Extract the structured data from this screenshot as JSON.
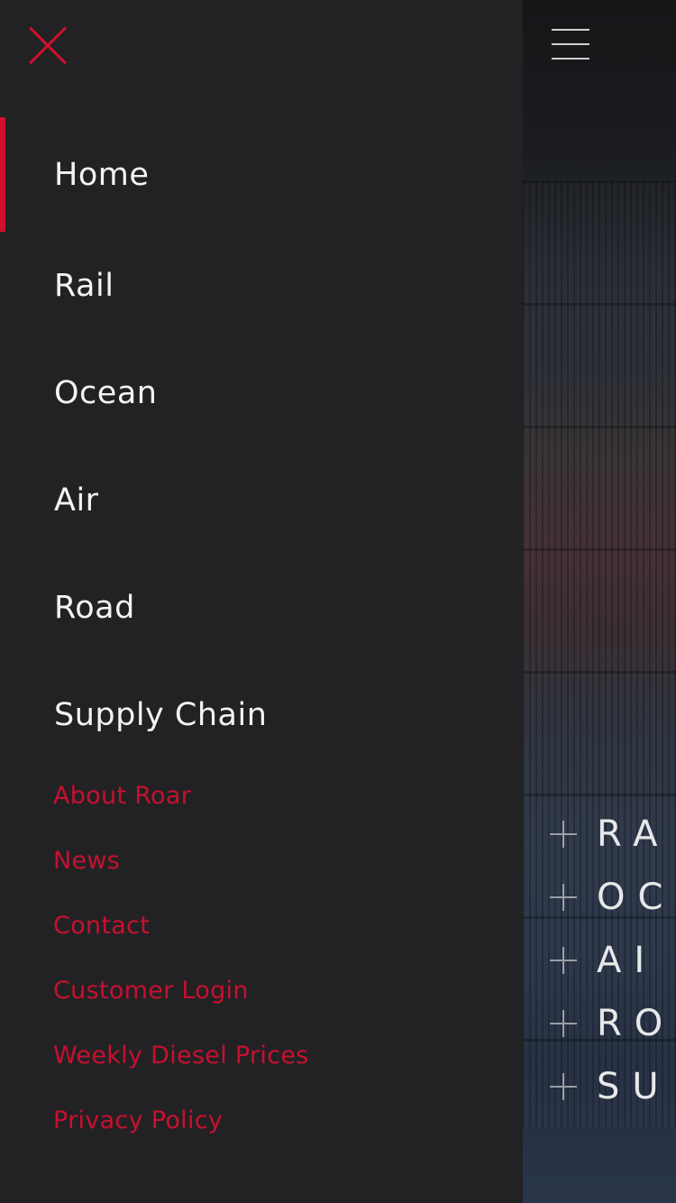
{
  "colors": {
    "accent": "#d0102e",
    "drawer_bg": "#222224",
    "primary_text": "#f3f3f3"
  },
  "drawer": {
    "close_icon": "close-icon",
    "primary_nav": [
      {
        "label": "Home",
        "active": true
      },
      {
        "label": "Rail",
        "active": false
      },
      {
        "label": "Ocean",
        "active": false
      },
      {
        "label": "Air",
        "active": false
      },
      {
        "label": "Road",
        "active": false
      },
      {
        "label": "Supply Chain",
        "active": false
      }
    ],
    "secondary_nav": [
      {
        "label": "About Roar"
      },
      {
        "label": "News"
      },
      {
        "label": "Contact"
      },
      {
        "label": "Customer Login"
      },
      {
        "label": "Weekly Diesel Prices"
      },
      {
        "label": "Privacy Policy"
      }
    ]
  },
  "background_page": {
    "menu_icon": "hamburger-menu-icon",
    "visible_service_fragments": [
      "RA",
      "OC",
      "AI",
      "RO",
      "SU"
    ]
  }
}
